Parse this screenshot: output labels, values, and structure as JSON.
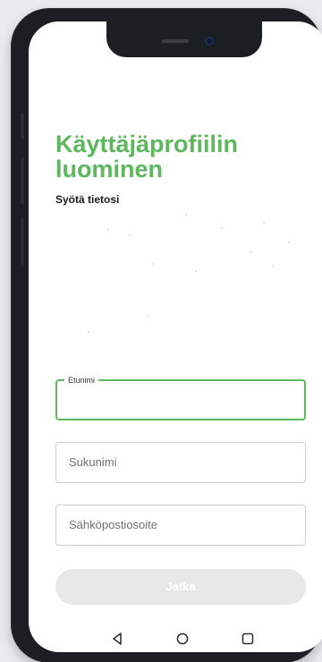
{
  "header": {
    "title": "Käyttäjäprofiilin luominen",
    "subtitle": "Syötä tietosi"
  },
  "form": {
    "first_name": {
      "label": "Etunimi",
      "value": ""
    },
    "last_name": {
      "placeholder": "Sukunimi",
      "value": ""
    },
    "email": {
      "placeholder": "Sähköpostiosoite",
      "value": ""
    },
    "continue_label": "Jatka"
  },
  "colors": {
    "accent": "#5cb85c",
    "button_disabled": "#e8e8e8"
  },
  "navbar": {
    "icons": [
      "back-icon",
      "home-icon",
      "recents-icon"
    ]
  }
}
